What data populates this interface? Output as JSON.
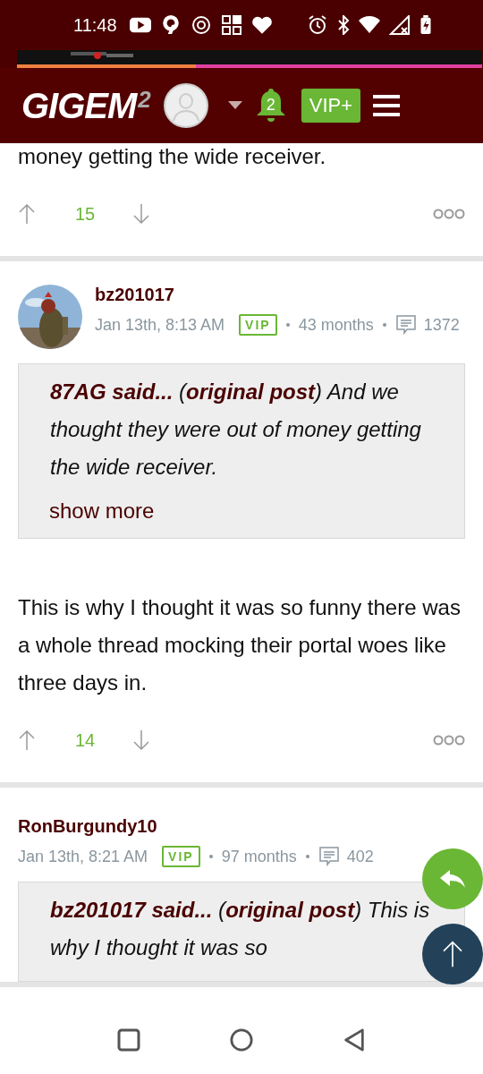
{
  "status_bar": {
    "time": "11:48"
  },
  "header": {
    "logo": "GIGEM",
    "logo_sup": "2",
    "notifications": "2",
    "vip_button": "VIP+"
  },
  "posts": [
    {
      "kind": "tail",
      "body": "money getting the wide receiver.",
      "votes": "15"
    },
    {
      "kind": "full",
      "author": "bz201017",
      "date": "Jan 13th, 8:13 AM",
      "badge": "VIP",
      "tenure": "43 months",
      "post_count": "1372",
      "quote": "**87AG said...** (**original post**) And we thought they were out of money getting the wide receiver.",
      "show_more": "show more",
      "body": "This is why I thought it was so funny there was a whole thread mocking their portal woes like three days in.",
      "votes": "14"
    },
    {
      "kind": "full",
      "author": "RonBurgundy10",
      "date": "Jan 13th, 8:21 AM",
      "badge": "VIP",
      "tenure": "97 months",
      "post_count": "402",
      "quote": "**bz201017 said...** (**original post**) This is why I thought it was so"
    }
  ]
}
